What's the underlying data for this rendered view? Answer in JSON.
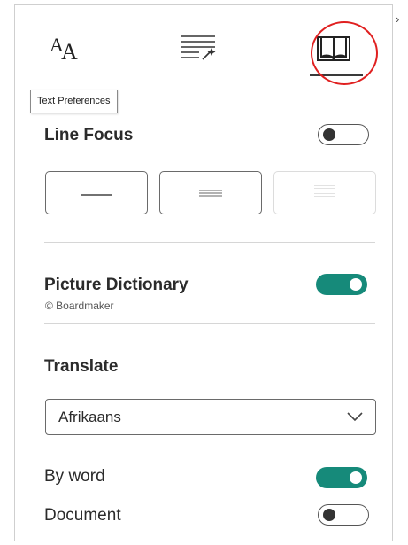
{
  "tabs": [
    {
      "name": "text-preferences",
      "icon": "text-size-icon",
      "glyph_big": "A",
      "glyph_small": "A"
    },
    {
      "name": "grammar-options",
      "icon": "grammar-options-icon"
    },
    {
      "name": "reading-preferences",
      "icon": "book-icon",
      "active": true
    }
  ],
  "tooltip": "Text Preferences",
  "line_focus": {
    "label": "Line Focus",
    "enabled": false,
    "options": [
      "one-line-icon",
      "three-lines-icon",
      "five-lines-icon"
    ]
  },
  "picture_dictionary": {
    "label": "Picture Dictionary",
    "credit": "© Boardmaker",
    "enabled": true
  },
  "translate": {
    "heading": "Translate",
    "language": "Afrikaans",
    "by_word": {
      "label": "By word",
      "enabled": true
    },
    "document": {
      "label": "Document",
      "enabled": false
    }
  },
  "colors": {
    "accent": "#168a7a",
    "annotation_circle": "#e02020"
  }
}
